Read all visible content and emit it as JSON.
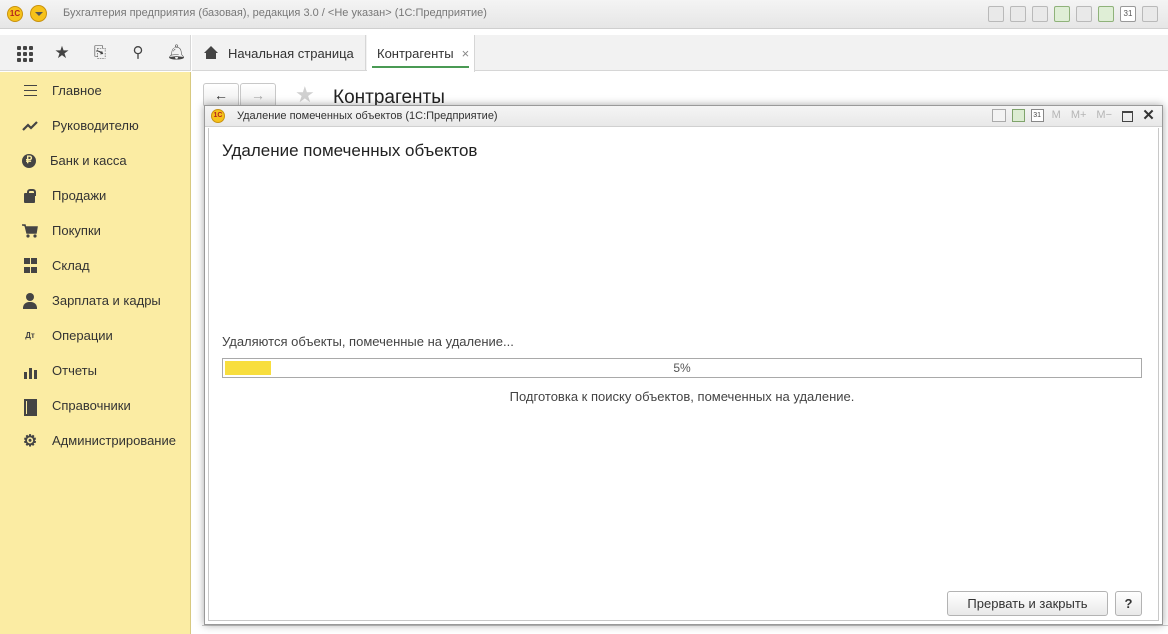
{
  "window": {
    "logo_text": "1С",
    "title": "Бухгалтерия предприятия (базовая), редакция 3.0 / <Не указан>  (1С:Предприятие)",
    "calendar_day": "31"
  },
  "tabs": {
    "home_label": "Начальная страница",
    "active_label": "Контрагенты",
    "close_glyph": "×"
  },
  "sidebar": {
    "items": [
      {
        "label": "Главное",
        "icon": "menu-icon"
      },
      {
        "label": "Руководителю",
        "icon": "trend-icon"
      },
      {
        "label": "Банк и касса",
        "icon": "ruble-icon",
        "glyph": "₽"
      },
      {
        "label": "Продажи",
        "icon": "bag-icon"
      },
      {
        "label": "Покупки",
        "icon": "cart-icon",
        "glyph": "🛒"
      },
      {
        "label": "Склад",
        "icon": "warehouse-icon"
      },
      {
        "label": "Зарплата и кадры",
        "icon": "person-icon"
      },
      {
        "label": "Операции",
        "icon": "dt-kt-icon",
        "glyph": "Дт"
      },
      {
        "label": "Отчеты",
        "icon": "bar-chart-icon"
      },
      {
        "label": "Справочники",
        "icon": "books-icon"
      },
      {
        "label": "Администрирование",
        "icon": "gear-icon",
        "glyph": "⚙"
      }
    ]
  },
  "background_page": {
    "back_glyph": "←",
    "forward_glyph": "→",
    "star_glyph": "★",
    "title": "Контрагенты"
  },
  "dialog": {
    "title": "Удаление помеченных объектов  (1С:Предприятие)",
    "calendar_day": "31",
    "m_label": "M",
    "mplus_label": "M+",
    "mminus_label": "M−",
    "close_glyph": "✕",
    "heading": "Удаление помеченных объектов",
    "status": "Удаляются объекты, помеченные на удаление...",
    "progress_label": "5%",
    "progress_fraction": 0.05,
    "description": "Подготовка к поиску объектов, помеченных на удаление.",
    "abort_button": "Прервать и закрыть",
    "help_button": "?"
  },
  "colors": {
    "sidebar_bg": "#fbeca3",
    "progress_fill": "#f8de3e",
    "active_tab_underline": "#4a9a54"
  }
}
